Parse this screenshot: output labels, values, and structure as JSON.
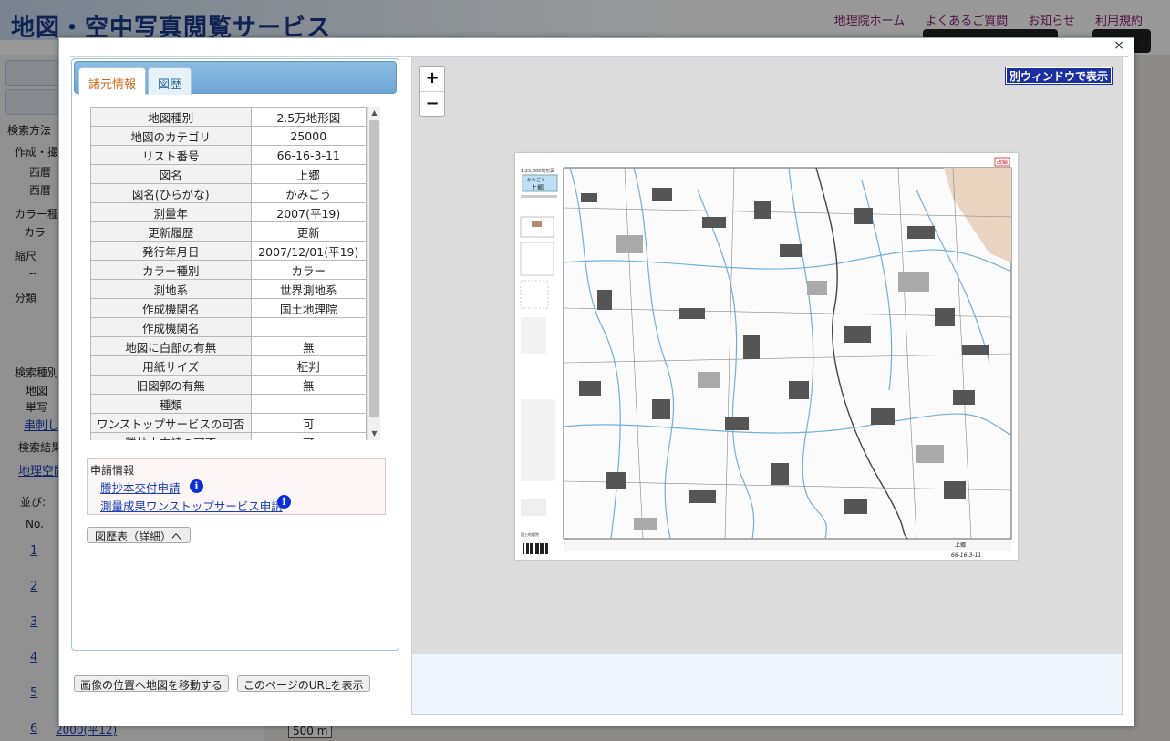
{
  "background": {
    "site_title": "地図・空中写真閲覧サービス",
    "header_links": [
      "地理院ホーム",
      "よくあるご質問",
      "お知らせ",
      "利用規約"
    ],
    "sidebar_texts": [
      "検索方法",
      "作成・撮",
      "西暦",
      "西暦",
      "カラー種",
      "カラ",
      "縮尺",
      "--",
      "分類",
      "検索種別",
      "地図",
      "単写",
      "串刺しル",
      "検索結果",
      "並び:",
      "No."
    ],
    "sidebar_link": "地理空間",
    "row_numbers": [
      "1",
      "2",
      "3",
      "4",
      "5",
      "6"
    ],
    "row6_year": "2000(平12)",
    "scale_label": "500 m"
  },
  "modal": {
    "close": "×",
    "tabs": [
      {
        "label": "諸元情報",
        "active": true
      },
      {
        "label": "図歴",
        "active": false
      }
    ],
    "properties": [
      {
        "key": "地図種別",
        "value": "2.5万地形図"
      },
      {
        "key": "地図のカテゴリ",
        "value": "25000"
      },
      {
        "key": "リスト番号",
        "value": "66-16-3-11"
      },
      {
        "key": "図名",
        "value": "上郷"
      },
      {
        "key": "図名(ひらがな)",
        "value": "かみごう"
      },
      {
        "key": "測量年",
        "value": "2007(平19)"
      },
      {
        "key": "更新履歴",
        "value": "更新"
      },
      {
        "key": "発行年月日",
        "value": "2007/12/01(平19)"
      },
      {
        "key": "カラー種別",
        "value": "カラー"
      },
      {
        "key": "測地系",
        "value": "世界測地系"
      },
      {
        "key": "作成機関名",
        "value": "国土地理院"
      },
      {
        "key": "作成機関名",
        "value": ""
      },
      {
        "key": "地図に白部の有無",
        "value": "無"
      },
      {
        "key": "用紙サイズ",
        "value": "柾判"
      },
      {
        "key": "旧図郭の有無",
        "value": "無"
      },
      {
        "key": "種類",
        "value": ""
      },
      {
        "key": "ワンストップサービスの可否",
        "value": "可"
      },
      {
        "key": "謄抄本申請の可否",
        "value": "可"
      }
    ],
    "apply": {
      "title": "申請情報",
      "links": [
        "謄抄本交付申請",
        "測量成果ワンストップサービス申請"
      ],
      "info_icon": "i"
    },
    "history_button": "図歴表（詳細）へ",
    "move_button": "画像の位置へ地図を移動する",
    "url_button": "このページのURLを表示",
    "viewer": {
      "zoom_in": "+",
      "zoom_out": "−",
      "separate_window": "別ウィンドウで表示"
    },
    "map_sheet": {
      "scale_text": "1:25,000地形図",
      "name_kana": "かみごう",
      "name": "上郷",
      "stamp": "改編",
      "sheet_number": "66-16-3-11",
      "publisher": "国土地理院"
    }
  }
}
